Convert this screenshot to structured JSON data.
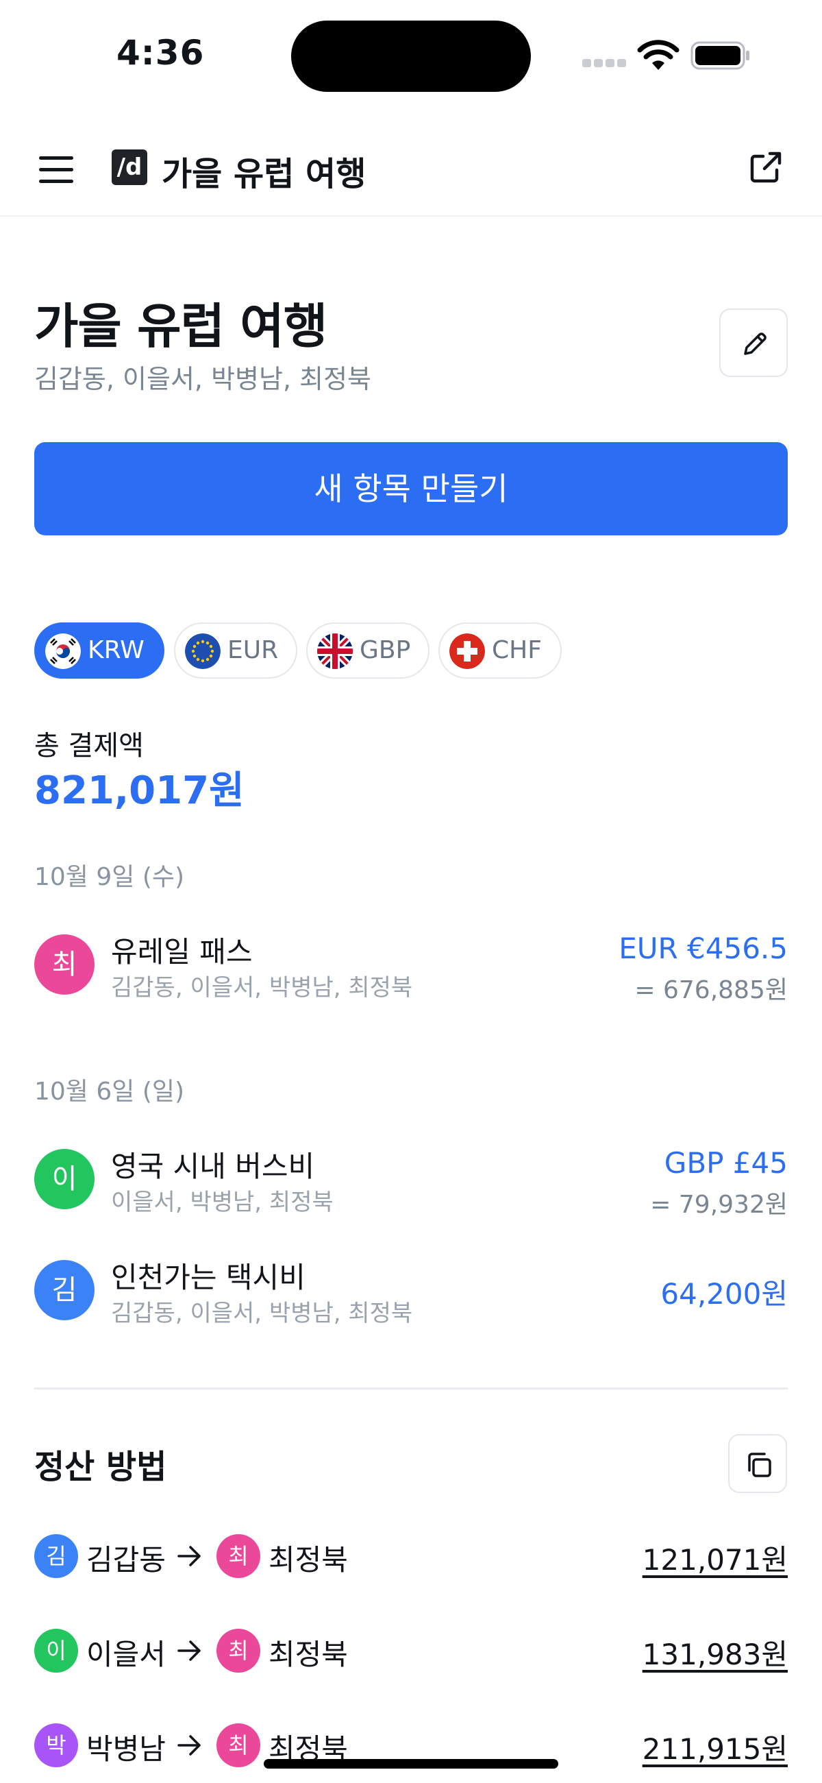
{
  "status_bar": {
    "time": "4:36"
  },
  "app_bar": {
    "logo": "/d",
    "title": "가을 유럽 여행"
  },
  "header": {
    "title": "가을 유럽 여행",
    "members": "김갑동, 이을서, 박병남, 최정북"
  },
  "create_button": "새 항목 만들기",
  "currencies": [
    {
      "code": "KRW",
      "active": true
    },
    {
      "code": "EUR",
      "active": false
    },
    {
      "code": "GBP",
      "active": false
    },
    {
      "code": "CHF",
      "active": false
    }
  ],
  "total": {
    "label": "총 결제액",
    "value": "821,017원"
  },
  "groups": [
    {
      "date": "10월 9일 (수)",
      "items": [
        {
          "avatar": "최",
          "avatar_color": "#ec4899",
          "title": "유레일 패스",
          "members": "김갑동, 이을서, 박병남, 최정북",
          "amount": "EUR €456.5",
          "converted": "= 676,885원"
        }
      ]
    },
    {
      "date": "10월 6일 (일)",
      "items": [
        {
          "avatar": "이",
          "avatar_color": "#22c55e",
          "title": "영국 시내 버스비",
          "members": "이을서, 박병남, 최정북",
          "amount": "GBP £45",
          "converted": "= 79,932원"
        },
        {
          "avatar": "김",
          "avatar_color": "#3b82f6",
          "title": "인천가는 택시비",
          "members": "김갑동, 이을서, 박병남, 최정북",
          "amount": "64,200원",
          "converted": ""
        }
      ]
    }
  ],
  "settlement": {
    "title": "정산 방법",
    "rows": [
      {
        "from_avatar": "김",
        "from_color": "#3b82f6",
        "from": "김갑동",
        "to_avatar": "최",
        "to_color": "#ec4899",
        "to": "최정북",
        "amount": "121,071원"
      },
      {
        "from_avatar": "이",
        "from_color": "#22c55e",
        "from": "이을서",
        "to_avatar": "최",
        "to_color": "#ec4899",
        "to": "최정북",
        "amount": "131,983원"
      },
      {
        "from_avatar": "박",
        "from_color": "#a855f7",
        "from": "박병남",
        "to_avatar": "최",
        "to_color": "#ec4899",
        "to": "최정북",
        "amount": "211,915원"
      }
    ]
  },
  "colors": {
    "accent": "#2b6ef3",
    "muted": "#7a8592"
  },
  "icons": [
    "menu-icon",
    "share-icon",
    "edit-icon",
    "copy-icon",
    "arrow-right-icon",
    "wifi-icon",
    "battery-icon",
    "flag-kr-icon",
    "flag-eu-icon",
    "flag-gb-icon",
    "flag-ch-icon"
  ]
}
